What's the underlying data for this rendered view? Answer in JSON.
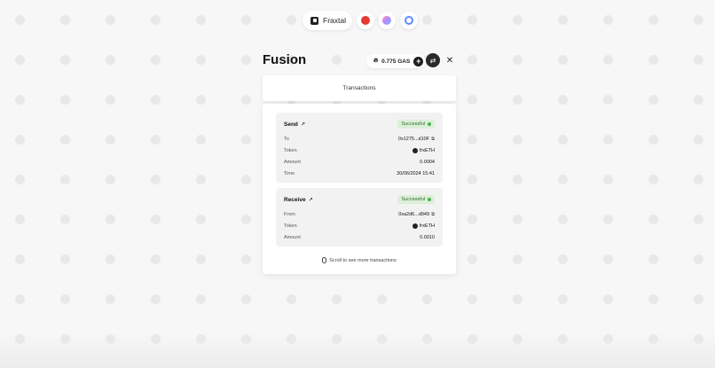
{
  "topbar": {
    "brand": "Fraxtal",
    "chains": [
      "chain-red",
      "chain-gradient",
      "chain-blue"
    ]
  },
  "header": {
    "title": "Fusion",
    "gas": "0.775 GAS",
    "plus_icon": "+",
    "swap_icon": "⇄",
    "close_icon": "✕"
  },
  "tabs": {
    "transactions": "Transactions"
  },
  "transactions": [
    {
      "type": "Send",
      "status": "Successful",
      "rows": [
        {
          "label": "To",
          "value": "0x1275...d10F"
        },
        {
          "label": "Token",
          "value": "frxETH"
        },
        {
          "label": "Amount",
          "value": "0.0004"
        },
        {
          "label": "Time",
          "value": "30/06/2024 15:41"
        }
      ]
    },
    {
      "type": "Receive",
      "status": "Successful",
      "rows": [
        {
          "label": "From",
          "value": "0xa2d6...d949"
        },
        {
          "label": "Token",
          "value": "frxETH"
        },
        {
          "label": "Amount",
          "value": "0.0010"
        }
      ]
    }
  ],
  "footer": {
    "scroll_hint": "Scroll to see more transactions"
  },
  "colors": {
    "success_bg": "#dcefd8",
    "success_dot": "#4caf50",
    "accent": "#1f1f1f"
  }
}
